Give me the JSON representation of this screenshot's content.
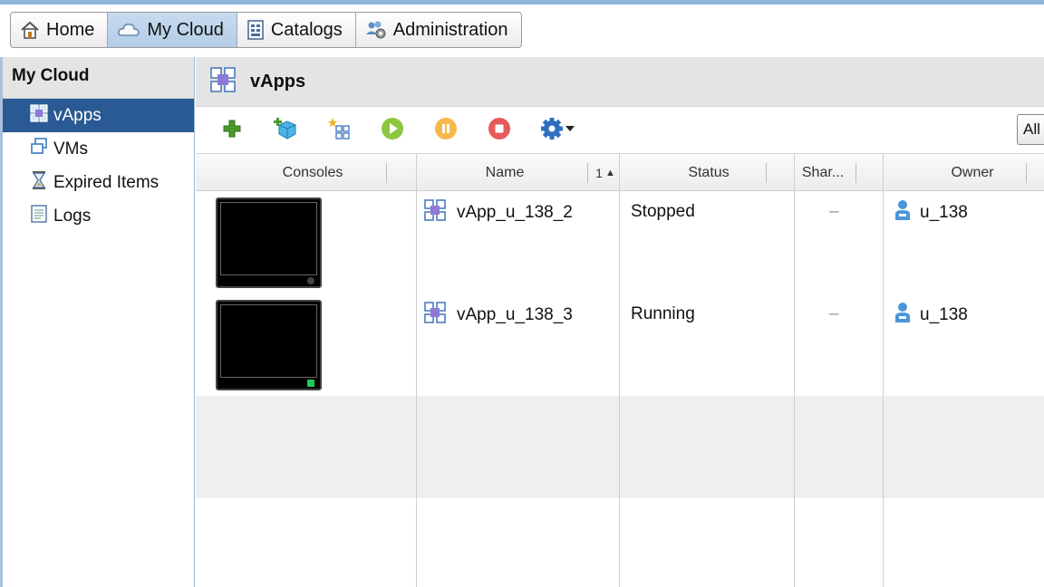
{
  "tabs": [
    {
      "label": "Home",
      "icon": "home-icon"
    },
    {
      "label": "My Cloud",
      "icon": "cloud-icon",
      "active": true
    },
    {
      "label": "Catalogs",
      "icon": "catalog-icon"
    },
    {
      "label": "Administration",
      "icon": "administration-icon"
    }
  ],
  "sidebar": {
    "title": "My Cloud",
    "items": [
      {
        "label": "vApps",
        "icon": "vapp-icon",
        "selected": true
      },
      {
        "label": "VMs",
        "icon": "vm-icon"
      },
      {
        "label": "Expired Items",
        "icon": "hourglass-icon"
      },
      {
        "label": "Logs",
        "icon": "log-icon"
      }
    ]
  },
  "main": {
    "title": "vApps",
    "filter_label": "All"
  },
  "toolbar": {
    "buttons": [
      "add-icon",
      "add-vapp-from-catalog-icon",
      "new-vapp-icon",
      "start-icon",
      "suspend-icon",
      "stop-icon",
      "actions-gear-icon"
    ]
  },
  "table": {
    "columns": {
      "consoles": "Consoles",
      "name": "Name",
      "sort_indicator": "1",
      "status": "Status",
      "shared": "Shar...",
      "owner": "Owner"
    },
    "rows": [
      {
        "name": "vApp_u_138_2",
        "status": "Stopped",
        "shared": "–",
        "owner": "u_138",
        "console_state": "stopped"
      },
      {
        "name": "vApp_u_138_3",
        "status": "Running",
        "shared": "–",
        "owner": "u_138",
        "console_state": "running"
      }
    ]
  },
  "colors": {
    "selected_nav": "#2a5a93",
    "active_tab": "#b3cce6",
    "start_green": "#8dc63f",
    "suspend_orange": "#f7b84b",
    "stop_red": "#e85a5a"
  }
}
